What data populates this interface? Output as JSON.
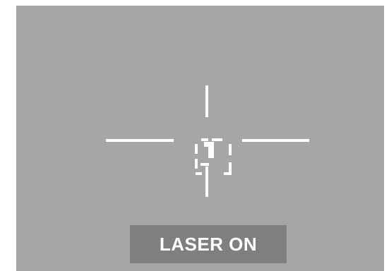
{
  "hud": {
    "reticle_icon": "crosshair-reticle-icon",
    "target_icon": "target-bracket-icon",
    "status_label": "LASER ON"
  },
  "colors": {
    "viewport_background": "#a6a6a6",
    "reticle": "#ffffff",
    "status_panel": "#7f7f7f",
    "status_text": "#ffffff"
  }
}
